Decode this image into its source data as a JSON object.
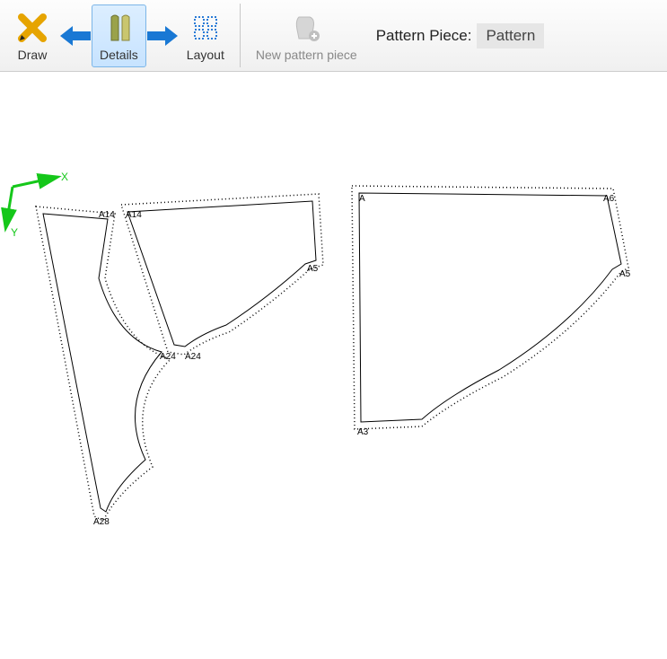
{
  "toolbar": {
    "draw": {
      "label": "Draw"
    },
    "details": {
      "label": "Details"
    },
    "layout": {
      "label": "Layout"
    },
    "new_piece": {
      "label": "New pattern piece"
    },
    "piece_label": "Pattern Piece:",
    "piece_value": "Pattern"
  },
  "axes": {
    "x": "X",
    "y": "Y"
  },
  "points": {
    "p1_a14a": "A14",
    "p1_a14b": "A14",
    "p1_a24": "A24",
    "p1_a28": "A28",
    "p2_a24": "A24",
    "p2_a5": "A5",
    "p3_a": "A",
    "p3_a6": "A6",
    "p3_a5": "A5",
    "p3_a3": "A3"
  },
  "colors": {
    "axis": "#15c71a",
    "toolbar_active_bg": "#c7e3ff",
    "toolbar_active_border": "#7cb6e8"
  }
}
